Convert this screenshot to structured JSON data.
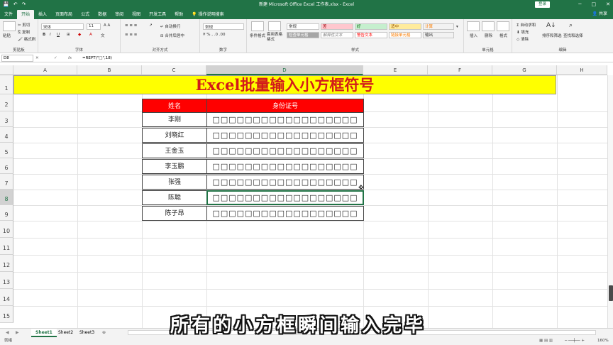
{
  "window": {
    "title": "新建 Microsoft Office Excel 工作表.xlsx - Excel",
    "login": "登录",
    "qat": [
      "💾",
      "↶",
      "↷"
    ]
  },
  "tabs": [
    "文件",
    "开始",
    "插入",
    "页面布局",
    "公式",
    "数据",
    "审阅",
    "视图",
    "开发工具",
    "帮助",
    "操作说明搜索"
  ],
  "share": "共享",
  "ribbon": {
    "clipboard": {
      "paste": "粘贴",
      "cut": "剪切",
      "copy": "复制",
      "painter": "格式刷",
      "label": "剪贴板"
    },
    "font": {
      "name": "宋体",
      "size": "11",
      "label": "字体",
      "bold": "B",
      "italic": "I",
      "underline": "U"
    },
    "align": {
      "wrap": "自动换行",
      "merge": "合并后居中",
      "label": "对齐方式"
    },
    "number": {
      "format": "常规",
      "label": "数字"
    },
    "styles": {
      "cond": "条件格式",
      "table": "套用表格格式",
      "normal": "常规",
      "bad": "差",
      "good": "好",
      "neutral": "适中",
      "calc": "计算",
      "check": "检查单元格",
      "explain": "解释性文本",
      "warn": "警告文本",
      "link": "链接单元格",
      "output": "输出",
      "label": "样式"
    },
    "cells": {
      "insert": "插入",
      "delete": "删除",
      "format": "格式",
      "label": "单元格"
    },
    "edit": {
      "autosum": "自动求和",
      "fill": "填充",
      "clear": "清除",
      "sort": "排序和筛选",
      "find": "查找和选择",
      "label": "编辑"
    }
  },
  "formula_bar": {
    "namebox": "D8",
    "fx": "fx",
    "formula": "=REPT(\"□\",18)"
  },
  "columns": [
    "A",
    "B",
    "C",
    "D",
    "E",
    "F",
    "G",
    "H"
  ],
  "rows": [
    "1",
    "2",
    "3",
    "4",
    "5",
    "6",
    "7",
    "8",
    "9",
    "10",
    "11",
    "12",
    "13",
    "14",
    "15"
  ],
  "sheet": {
    "title": "Excel批量输入小方框符号",
    "header": {
      "name": "姓名",
      "id": "身份证号"
    },
    "names": [
      "李刚",
      "刘晓红",
      "王金玉",
      "李玉鹏",
      "张强",
      "陈聪",
      "陈子昂"
    ],
    "boxes": "□□□□□□□□□□□□□□□□□□"
  },
  "sheets": [
    "Sheet1",
    "Sheet2",
    "Sheet3"
  ],
  "add_sheet": "⊕",
  "status": {
    "left": "就绪",
    "zoom": "160%"
  },
  "subtitle": "所有的小方框瞬间输入完毕"
}
